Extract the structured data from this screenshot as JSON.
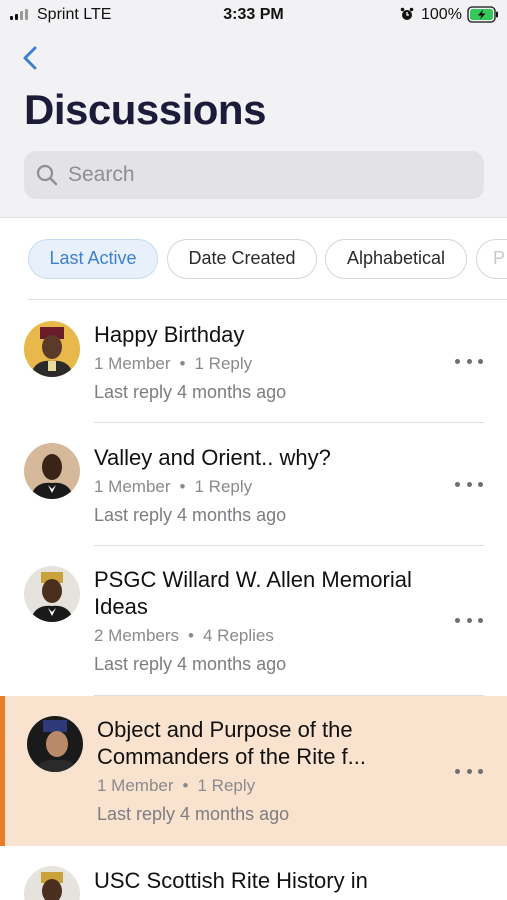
{
  "status_bar": {
    "carrier": "Sprint  LTE",
    "time": "3:33 PM",
    "battery": "100%"
  },
  "header": {
    "title": "Discussions",
    "back_icon": "chevron-left-icon"
  },
  "search": {
    "placeholder": "Search",
    "value": ""
  },
  "filters": [
    {
      "label": "Last Active",
      "active": true
    },
    {
      "label": "Date Created",
      "active": false
    },
    {
      "label": "Alphabetical",
      "active": false
    },
    {
      "label": "P",
      "active": false
    }
  ],
  "discussions": [
    {
      "title": "Happy Birthday",
      "members": "1 Member",
      "replies": "1 Reply",
      "last_reply": "Last reply 4 months ago",
      "highlighted": false
    },
    {
      "title": "Valley and Orient.. why?",
      "members": "1 Member",
      "replies": "1 Reply",
      "last_reply": "Last reply 4 months ago",
      "highlighted": false
    },
    {
      "title": "PSGC Willard W. Allen Memorial Ideas",
      "members": "2 Members",
      "replies": "4 Replies",
      "last_reply": "Last reply 4 months ago",
      "highlighted": false
    },
    {
      "title": "Object and Purpose of the Commanders of the Rite f...",
      "members": "1 Member",
      "replies": "1 Reply",
      "last_reply": "Last reply 4 months ago",
      "highlighted": true
    },
    {
      "title": "USC Scottish Rite History in",
      "members": "",
      "replies": "",
      "last_reply": "",
      "highlighted": false
    }
  ],
  "colors": {
    "accent_blue": "#3d7fd0",
    "highlight_bg": "#f9e3cf",
    "highlight_bar": "#e97b2b",
    "title_dark": "#1c1c3a"
  }
}
